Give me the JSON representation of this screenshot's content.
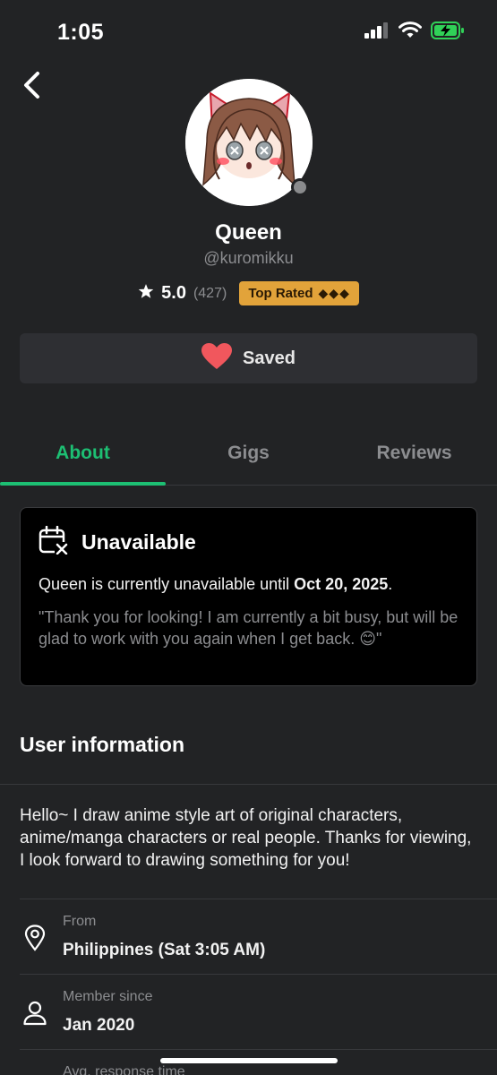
{
  "status_bar": {
    "time": "1:05",
    "icons": [
      "signal-icon",
      "wifi-icon",
      "battery-charging-icon"
    ]
  },
  "header": {
    "back_icon": "chevron-left-icon"
  },
  "profile": {
    "name": "Queen",
    "handle": "@kuromikku",
    "rating": "5.0",
    "review_count": "(427)",
    "badge_label": "Top Rated",
    "badge_diamonds": "◆◆◆",
    "online_status": "offline"
  },
  "saved_button": {
    "label": "Saved",
    "icon": "heart-icon"
  },
  "tabs": [
    {
      "label": "About",
      "active": true
    },
    {
      "label": "Gigs",
      "active": false
    },
    {
      "label": "Reviews",
      "active": false
    }
  ],
  "unavailable": {
    "title": "Unavailable",
    "message_prefix": "Queen is currently unavailable until ",
    "until_date": "Oct 20, 2025",
    "message_suffix": ".",
    "quote": "\"Thank you for looking! I am currently a bit busy, but will be glad to work with you again when I get back. 😊\""
  },
  "user_information": {
    "title": "User information",
    "bio": "Hello~ I draw anime style art of original characters, anime/manga characters or real people. Thanks for viewing, I look forward to drawing something for you!",
    "rows": [
      {
        "label": "From",
        "value": "Philippines (Sat 3:05 AM)",
        "icon": "location-pin-icon"
      },
      {
        "label": "Member since",
        "value": "Jan 2020",
        "icon": "user-icon"
      },
      {
        "label": "Avg. response time",
        "value": "",
        "icon": "clock-icon"
      }
    ]
  },
  "colors": {
    "background": "#222325",
    "accent_green": "#1dbf73",
    "badge_gold": "#e2a33a",
    "heart_red": "#f1575d"
  }
}
